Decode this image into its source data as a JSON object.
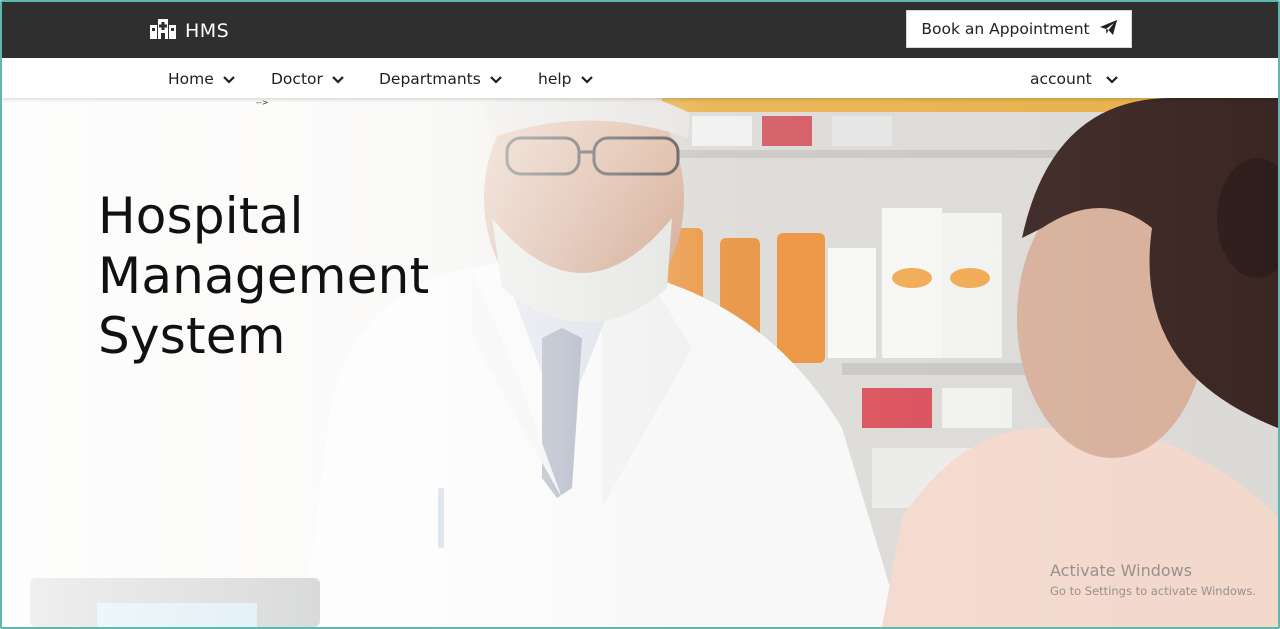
{
  "header": {
    "brand": "HMS",
    "brand_icon": "hospital-icon",
    "book_button": "Book an Appointment",
    "book_icon": "paper-plane-icon"
  },
  "nav": {
    "items": [
      {
        "label": "Home"
      },
      {
        "label": "Doctor"
      },
      {
        "label": "Departmants"
      },
      {
        "label": "help"
      }
    ],
    "account": "account",
    "stray_text": "-->"
  },
  "hero": {
    "title_lines": [
      "Hospital",
      "Management",
      "System"
    ]
  },
  "watermark": {
    "line1": "Activate Windows",
    "line2": "Go to Settings to activate Windows."
  },
  "colors": {
    "topbar": "#2f2f2f",
    "frame_border": "#5fb8b0"
  }
}
